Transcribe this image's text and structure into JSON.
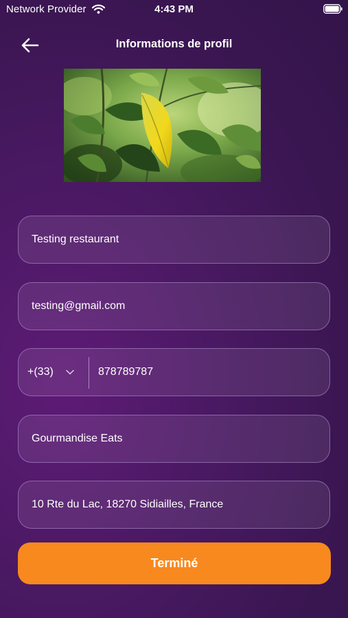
{
  "status_bar": {
    "carrier": "Network Provider",
    "time": "4:43 PM"
  },
  "header": {
    "title": "Informations de profil",
    "back_icon": "arrow-left-icon"
  },
  "profile_photo": {
    "description_icon": "restaurant-photo"
  },
  "form": {
    "name": "Testing restaurant",
    "email": "testing@gmail.com",
    "phone": {
      "country_code": "+(33)",
      "number": "878789787"
    },
    "restaurant": "Gourmandise Eats",
    "address": "10 Rte du Lac, 18270 Sidiailles, France"
  },
  "done_button": {
    "label": "Terminé",
    "color": "#f7891f"
  },
  "theme": {
    "background": "#4a1963",
    "accent": "#f7891f"
  }
}
